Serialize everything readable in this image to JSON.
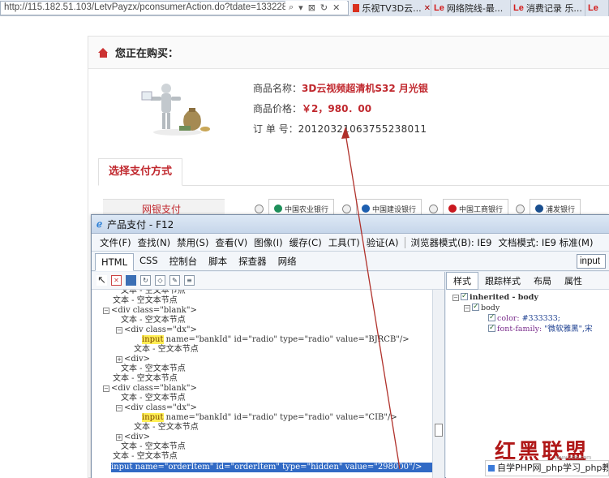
{
  "browser": {
    "address": "http://115.182.51.103/LetvPayzx/pconsumerAction.do?tdate=133228",
    "address_controls": [
      "⌕",
      "▾",
      "⊠",
      "↻",
      "✕"
    ],
    "tabs": [
      {
        "brand": "",
        "label": "乐视TV3D云..."
      },
      {
        "brand": "Le",
        "label": "网络院线-最..."
      },
      {
        "brand": "Le",
        "label": "消费记录 乐..."
      },
      {
        "brand": "Le",
        "label": ""
      }
    ]
  },
  "page": {
    "heading": "您正在购买：",
    "product": {
      "name_label": "商品名称：",
      "name_value": "3D云视频超清机S32 月光银",
      "price_label": "商品价格：",
      "price_value": "￥2，980．00",
      "order_label": "订 单 号：",
      "order_value": "20120321063755238011"
    },
    "pay_tab": "选择支付方式",
    "netpay_label": "网银支付",
    "banks": [
      "中国农业银行",
      "中国建设银行",
      "中国工商银行",
      "浦发银行"
    ]
  },
  "devtools": {
    "title": "产品支付 - F12",
    "menu": [
      "文件(F)",
      "查找(N)",
      "禁用(S)",
      "查看(V)",
      "图像(I)",
      "缓存(C)",
      "工具(T)",
      "验证(A)",
      "浏览器模式(B): IE9",
      "文档模式: IE9 标准(M)"
    ],
    "tabs": [
      "HTML",
      "CSS",
      "控制台",
      "脚本",
      "探查器",
      "网络"
    ],
    "search_value": "input",
    "right_tabs": [
      "样式",
      "跟踪样式",
      "布局",
      "属性"
    ],
    "tree": {
      "text_node": "文本 - 空文本节点",
      "div_blank": "<div class=\"blank\">",
      "div_dx": "<div class=\"dx\">",
      "div_close": "<div>",
      "input_tag": "input",
      "input_rest_1": " name=\"bankId\" id=\"radio\" type=\"radio\" value=\"BJRCB\"/>",
      "input_rest_2": " name=\"bankId\" id=\"radio\" type=\"radio\" value=\"CIB\"/>",
      "selected_line": "input name=\"orderItem\" id=\"orderItem\" type=\"hidden\" value=\"298000\"/>"
    },
    "styles": {
      "inherited": "inherited - body",
      "body": "body",
      "color_prop": "color:",
      "color_val": "#333333;",
      "font_prop": "font-family:",
      "font_val": "\"微软雅黑\",宋"
    }
  },
  "watermark": {
    "logo": "红黑联盟",
    "url": "www.2cto.com",
    "bar_text": "自学PHP网_php学习_php教程"
  }
}
